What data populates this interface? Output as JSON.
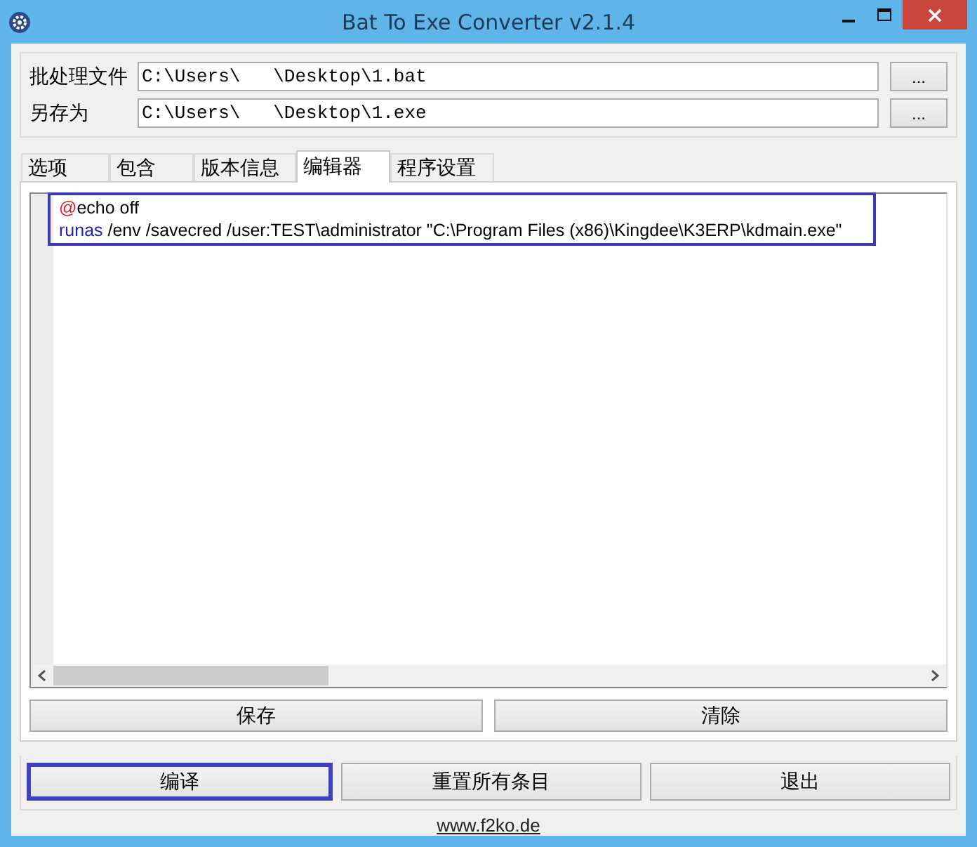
{
  "window": {
    "title": "Bat To Exe Converter v2.1.4"
  },
  "files": [
    {
      "label": "批处理文件",
      "value": "C:\\Users\\   \\Desktop\\1.bat",
      "browse": "..."
    },
    {
      "label": "另存为",
      "value": "C:\\Users\\   \\Desktop\\1.exe",
      "browse": "..."
    }
  ],
  "tabs": [
    {
      "label": "选项",
      "selected": false
    },
    {
      "label": "包含",
      "selected": false
    },
    {
      "label": "版本信息",
      "selected": false
    },
    {
      "label": "编辑器",
      "selected": true
    },
    {
      "label": "程序设置",
      "selected": false
    }
  ],
  "editor": {
    "lines": [
      [
        {
          "kind": "directive",
          "text": "@"
        },
        {
          "kind": "plain",
          "text": "echo off"
        }
      ],
      [
        {
          "kind": "keyword",
          "text": "runas"
        },
        {
          "kind": "plain",
          "text": " /env /savecred /user:TEST\\administrator \"C:\\Program Files (x86)\\Kingdee\\K3ERP\\kdmain.exe\""
        }
      ]
    ],
    "buttons": [
      "保存",
      "清除"
    ]
  },
  "actions": [
    {
      "label": "编译",
      "focused": true
    },
    {
      "label": "重置所有条目",
      "focused": false
    },
    {
      "label": "退出",
      "focused": false
    }
  ],
  "link": "www.f2ko.de"
}
